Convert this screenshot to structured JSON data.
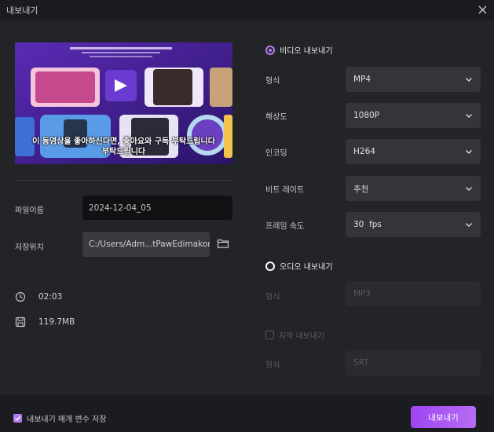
{
  "window": {
    "title": "내보내기"
  },
  "preview": {
    "caption_line1": "이 동영상을 좋아하신다면, 좋아요와 구독 부탁드립니다",
    "caption_line2": "부탁드립니다"
  },
  "file": {
    "name_label": "파일이름",
    "name_value": "2024-12-04_05",
    "location_label": "저장위치",
    "location_value": "C:/Users/Adm...tPawEdimakor"
  },
  "info": {
    "duration": "02:03",
    "size": "119.7MB"
  },
  "video_export": {
    "label": "비디오 내보내기",
    "selected": true,
    "rows": [
      {
        "label": "형식",
        "value": "MP4"
      },
      {
        "label": "해상도",
        "value": "1080P"
      },
      {
        "label": "인코딩",
        "value": "H264"
      },
      {
        "label": "비트 레이트",
        "value": "추천"
      },
      {
        "label": "프레임 속도",
        "value": "30  fps"
      }
    ]
  },
  "audio_export": {
    "label": "오디오 내보내기",
    "selected": false,
    "format_label": "형식",
    "format_value": "MP3"
  },
  "subtitle_export": {
    "label": "자막 내보내기",
    "checked": false,
    "format_label": "형식",
    "format_value": "SRT"
  },
  "footer": {
    "save_params_label": "내보내기 매개 변수 저장",
    "save_params_checked": true,
    "export_button": "내보내기"
  },
  "colors": {
    "accent": "#b47cf0",
    "background": "#232428",
    "titlebar": "#1b1c20"
  }
}
